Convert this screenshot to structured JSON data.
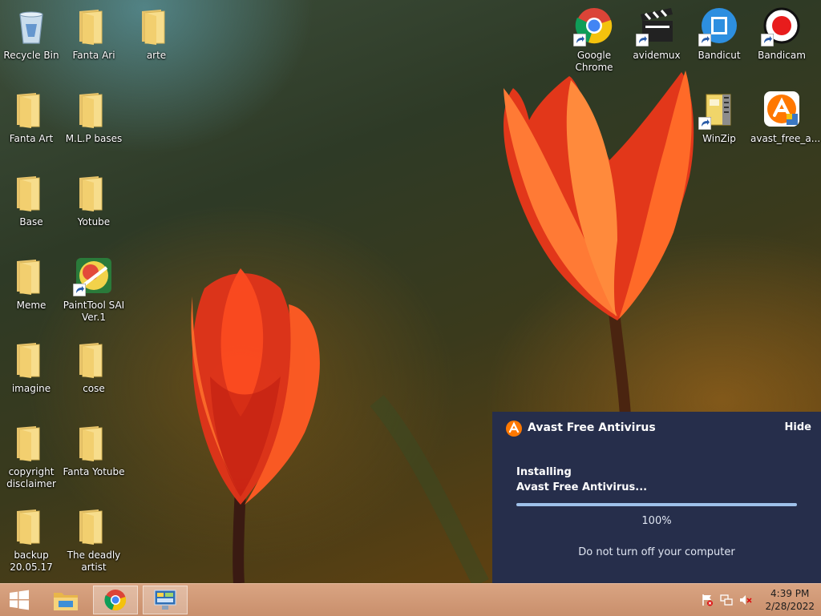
{
  "desktop": {
    "icons": [
      {
        "id": "recycle",
        "label": "Recycle Bin",
        "type": "recycle-bin",
        "shortcut": false
      },
      {
        "id": "fanta-ari",
        "label": "Fanta Ari",
        "type": "folder",
        "shortcut": false
      },
      {
        "id": "arte",
        "label": "arte",
        "type": "folder",
        "shortcut": false
      },
      {
        "id": "fanta-art",
        "label": "Fanta Art",
        "type": "folder",
        "shortcut": false
      },
      {
        "id": "mlp",
        "label": "M.L.P bases",
        "type": "folder",
        "shortcut": false
      },
      {
        "id": "base",
        "label": "Base",
        "type": "folder",
        "shortcut": false
      },
      {
        "id": "yotube",
        "label": "Yotube",
        "type": "folder",
        "shortcut": false
      },
      {
        "id": "meme",
        "label": "Meme",
        "type": "folder",
        "shortcut": false
      },
      {
        "id": "paintool",
        "label": "PaintTool SAI Ver.1",
        "type": "app-paintool",
        "shortcut": true
      },
      {
        "id": "imagine",
        "label": "imagine",
        "type": "folder",
        "shortcut": false
      },
      {
        "id": "cose",
        "label": "cose",
        "type": "folder",
        "shortcut": false
      },
      {
        "id": "copyright",
        "label": "copyright disclaimer",
        "type": "folder",
        "shortcut": false
      },
      {
        "id": "fanta-yotube",
        "label": "Fanta Yotube",
        "type": "folder",
        "shortcut": false
      },
      {
        "id": "backup",
        "label": "backup 20.05.17",
        "type": "folder",
        "shortcut": false
      },
      {
        "id": "deadly",
        "label": "The deadly artist",
        "type": "folder",
        "shortcut": false
      },
      {
        "id": "chrome",
        "label": "Google Chrome",
        "type": "app-chrome",
        "shortcut": true
      },
      {
        "id": "avidemux",
        "label": "avidemux",
        "type": "app-avidemux",
        "shortcut": true
      },
      {
        "id": "bandicut",
        "label": "Bandicut",
        "type": "app-bandicut",
        "shortcut": true
      },
      {
        "id": "bandicam",
        "label": "Bandicam",
        "type": "app-bandicam",
        "shortcut": true
      },
      {
        "id": "winzip",
        "label": "WinZip",
        "type": "app-winzip",
        "shortcut": true
      },
      {
        "id": "avast-setup",
        "label": "avast_free_a...",
        "type": "app-avast",
        "shortcut": false
      }
    ]
  },
  "notification": {
    "title": "Avast Free Antivirus",
    "hide_label": "Hide",
    "status_line1": "Installing",
    "status_line2": "Avast Free Antivirus...",
    "progress_value": 1.0,
    "progress_text": "100%",
    "warning": "Do not turn off your computer",
    "accent": "#ff7800",
    "background": "#262e4b"
  },
  "taskbar": {
    "start_icon": "windows-logo-icon",
    "pinned": [
      {
        "id": "explorer",
        "icon": "file-explorer-icon"
      },
      {
        "id": "chrome",
        "icon": "chrome-icon"
      },
      {
        "id": "control",
        "icon": "control-panel-icon"
      }
    ],
    "tray": [
      "action-center-flag-icon",
      "network-icon",
      "volume-muted-icon"
    ],
    "clock": {
      "time": "4:39 PM",
      "date": "2/28/2022"
    }
  }
}
